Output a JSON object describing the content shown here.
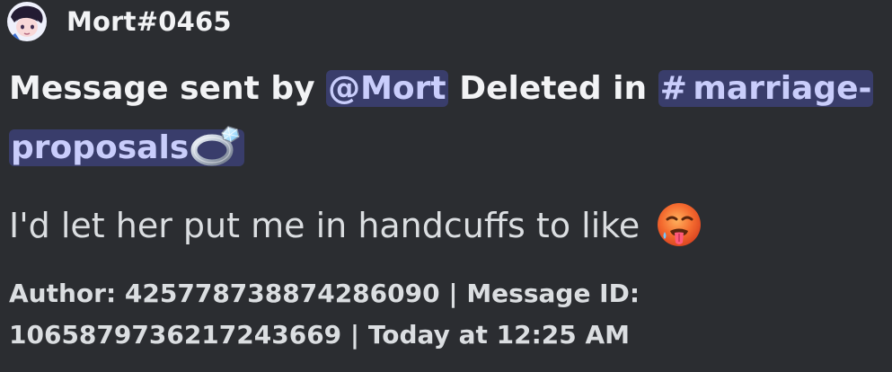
{
  "author": {
    "name": "Mort#0465"
  },
  "title": {
    "prefix": "Message sent by",
    "mention": "@Mort",
    "middle": "Deleted in",
    "channel_hash": "#",
    "channel_name": "marriage-proposals",
    "channel_icon": "ring-icon"
  },
  "message": {
    "text": "I'd let her put me in handcuffs to like",
    "emoji": "hot-face-icon"
  },
  "footer": {
    "text": "Author: 425778738874286090 | Message ID: 1065879736217243669 | Today at 12:25 AM"
  },
  "colors": {
    "background": "#2b2d31",
    "mention_background": "#3c4270",
    "mention_text": "#c9cdfb",
    "primary_text": "#f2f3f5",
    "message_text": "#dbdee1"
  }
}
